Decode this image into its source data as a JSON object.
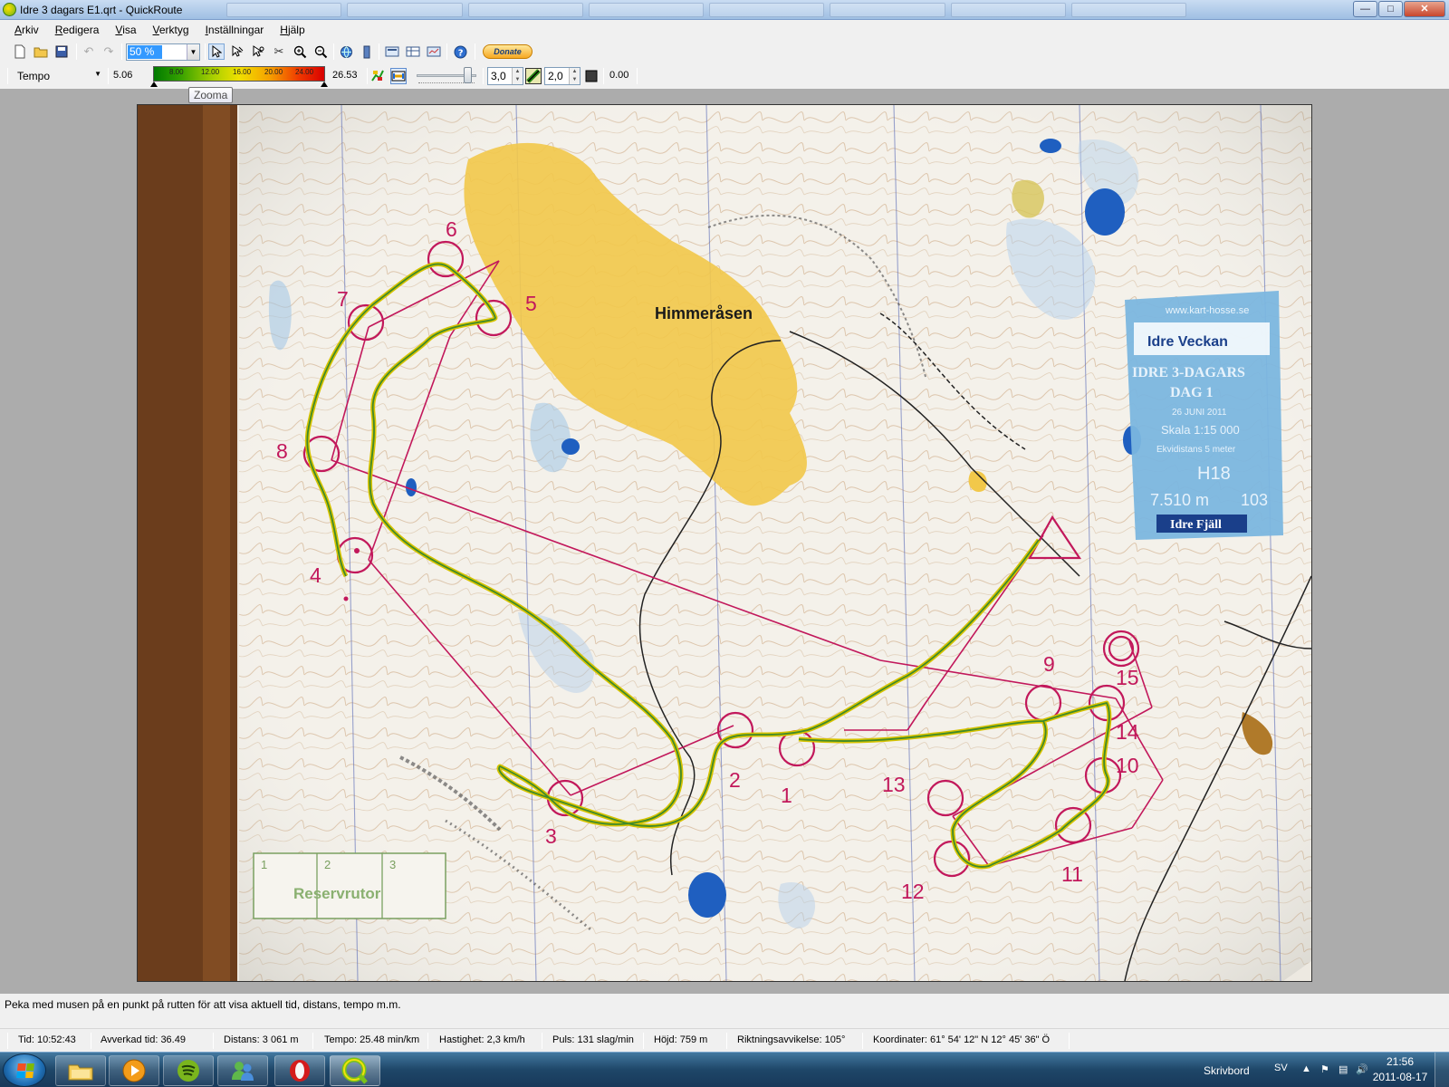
{
  "window": {
    "title": "Idre 3 dagars E1.qrt - QuickRoute",
    "minimize": "0",
    "maximize": "1",
    "close": "r"
  },
  "menu": [
    "Arkiv",
    "Redigera",
    "Visa",
    "Verktyg",
    "Inställningar",
    "Hjälp"
  ],
  "toolbar": {
    "zoom_value": "50 %",
    "donate_label": "Donate",
    "tooltip": "Zooma",
    "icons": [
      "new-file-icon",
      "open-folder-icon",
      "save-icon",
      "undo-icon",
      "redo-icon",
      "pointer-icon",
      "adjust-route-icon",
      "zoom-to-fit-icon",
      "cut-route-icon",
      "zoom-in-icon",
      "zoom-out-icon",
      "globe-icon",
      "vertical-bar-icon",
      "laps-icon",
      "view-icon",
      "export-icon",
      "help-icon"
    ]
  },
  "route_toolbar": {
    "color_coding": "Tempo",
    "range_min": "5.06",
    "range_max": "26.53",
    "gradient_ticks": [
      "8.00",
      "12.00",
      "16.00",
      "20.00",
      "24.00"
    ],
    "route_width": "3,0",
    "mask_width": "2,0",
    "tail_value": "0.00",
    "slider_level": 0.92,
    "colors": {
      "gradient_low": "#007a00",
      "gradient_mid": "#f0e000",
      "gradient_high": "#d80000"
    }
  },
  "map": {
    "place_name": "Himmeråsen",
    "control_numbers": [
      "1",
      "2",
      "3",
      "4",
      "5",
      "6",
      "7",
      "8",
      "9",
      "10",
      "11",
      "12",
      "13",
      "14",
      "15"
    ],
    "info_box": {
      "url": "www.kart-hosse.se",
      "logo": "Idre Veckan",
      "event": "IDRE 3-DAGARS",
      "day": "DAG 1",
      "date": "26 JUNI 2011",
      "scale": "Skala 1:15 000",
      "contour": "Ekvidistans 5 meter",
      "class": "H18",
      "distance": "7.510 m",
      "climb": "103",
      "footer": "Idre Fjäll"
    },
    "reserve_box": {
      "label": "Reservrutor",
      "numbers": [
        "1",
        "2",
        "3"
      ]
    },
    "colors": {
      "course_line": "#c2185b",
      "route_line": "#3f8a2a",
      "open_land": "#f2c84a",
      "water": "#1f5fc0"
    }
  },
  "hint": "Peka med musen på en punkt på rutten för att visa aktuell tid, distans, tempo m.m.",
  "status": {
    "tid": "Tid: 10:52:43",
    "avverkad": "Avverkad tid: 36.49",
    "distans": "Distans: 3 061 m",
    "tempo": "Tempo: 25.48 min/km",
    "hastighet": "Hastighet: 2,3 km/h",
    "puls": "Puls: 131 slag/min",
    "hojd": "Höjd: 759 m",
    "riktning": "Riktningsavvikelse: 105°",
    "koordinater": "Koordinater: 61° 54' 12\" N   12° 45' 36\" Ö"
  },
  "taskbar": {
    "apps": [
      "file-explorer-icon",
      "media-player-icon",
      "spotify-icon",
      "messenger-icon",
      "opera-icon",
      "quickroute-icon"
    ],
    "desktop_label": "Skrivbord",
    "language": "SV",
    "time": "21:56",
    "date": "2011-08-17"
  }
}
